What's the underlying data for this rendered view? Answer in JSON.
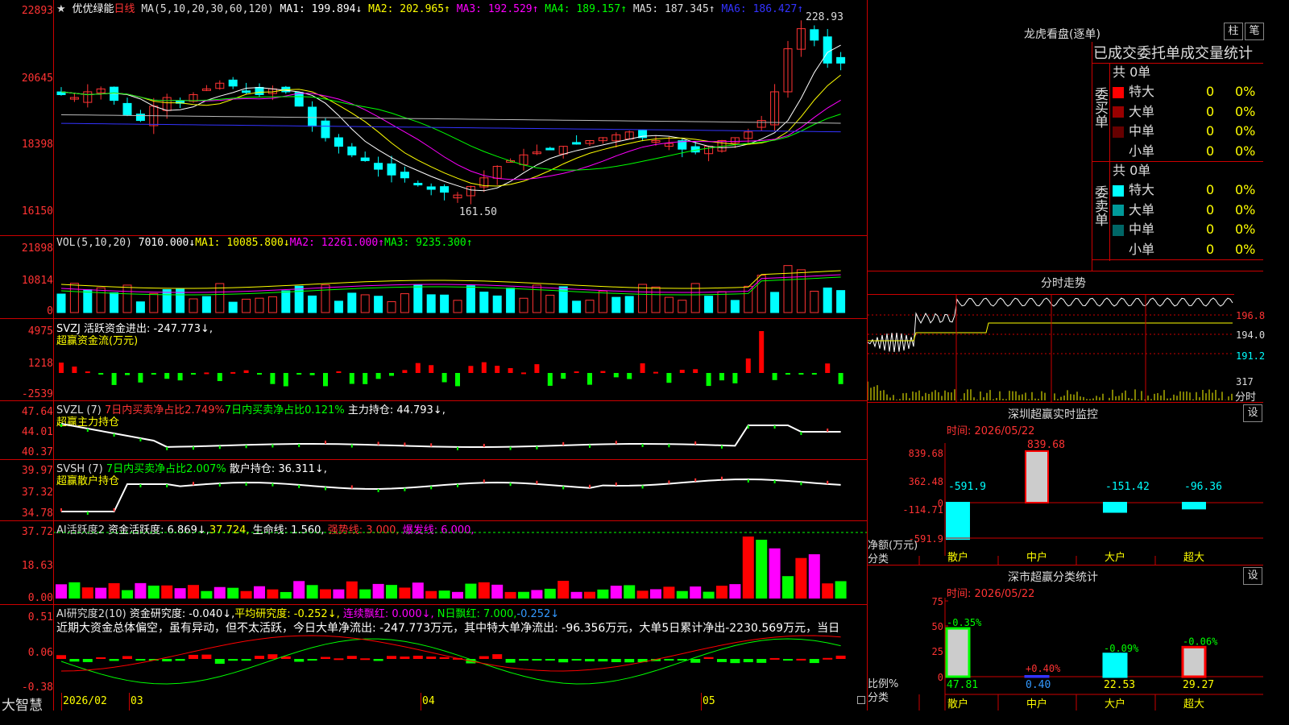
{
  "stock": {
    "name": "优优绿能",
    "period": "日线",
    "ma_label": "MA(5,10,20,30,60,120)",
    "ma": [
      {
        "label": "MA1: 199.894↓",
        "color": "#ffffff"
      },
      {
        "label": "MA2: 202.965↑",
        "color": "#ffff00"
      },
      {
        "label": "MA3: 192.529↑",
        "color": "#ff00ff"
      },
      {
        "label": "MA4: 189.157↑",
        "color": "#00ff00"
      },
      {
        "label": "MA5: 187.345↑",
        "color": "#cccccc"
      },
      {
        "label": "MA6: 186.427↑",
        "color": "#3333ff"
      }
    ],
    "price_axis": [
      "22893",
      "20645",
      "18398",
      "16150"
    ],
    "high_label": "228.93",
    "low_label": "161.50"
  },
  "vol": {
    "label": "VOL(5,10,20)",
    "value": "7010.000↓",
    "ma1": "MA1: 10085.800↓",
    "ma2": "MA2: 12261.000↑",
    "ma3": "MA3: 9235.300↑",
    "axis": [
      "21898",
      "10814",
      "0"
    ]
  },
  "svzj": {
    "label": "SVZJ  活跃资金进出: -247.773↓,",
    "sub": "超赢资金流(万元)",
    "axis": [
      "4975",
      "1218",
      "-2539"
    ]
  },
  "svzl": {
    "label": "SVZL (7)",
    "part1": "7日内买卖净占比2.749%",
    "part2": "7日内买卖净占比0.121%",
    "part3": "主力持仓: 44.793↓,",
    "sub": "超赢主力持仓",
    "axis": [
      "47.64",
      "44.01",
      "40.37"
    ]
  },
  "svsh": {
    "label": "SVSH (7)",
    "part1": "7日内买卖净占比2.007%",
    "part2": "散户持仓: 36.311↓,",
    "sub": "超赢散户持仓",
    "axis": [
      "39.97",
      "37.32",
      "34.78"
    ]
  },
  "ai1": {
    "label": "AI活跃度2",
    "part1": "资金活跃度: 6.869↓,",
    "part2": "37.724,",
    "part3": "生命线: 1.560,",
    "part4": "强势线: 3.000,",
    "part5": "爆发线: 6.000,",
    "axis": [
      "37.72",
      "18.63",
      "0.00"
    ]
  },
  "ai2": {
    "label": "AI研究度2(10)",
    "part1": "资金研究度: -0.040↓,",
    "part2": "平均研究度: -0.252↓,",
    "part3": "连续飘红: 0.000↓,",
    "part4": "N日飘红: 7.000,",
    "part5": "-0.252↓",
    "commentary": "近期大资金总体偏空，虽有异动，但不太活跃，今日大单净流出: -247.773万元，其中特大单净流出: -96.356万元，大单5日累计净出-2230.569万元，当日",
    "axis": [
      "0.51",
      "0.06",
      "-0.38"
    ]
  },
  "bottom": {
    "brand": "大智慧",
    "date_labels": [
      "2026/02",
      "03",
      "04",
      "05"
    ]
  },
  "right": {
    "title": "龙虎看盘(逐单)",
    "btn_bar": "柱",
    "btn_pen": "笔",
    "tabs": "已成交委托单成交量统计",
    "buy": {
      "side_label": "委买单",
      "total": "共 0单",
      "rows": [
        {
          "name": "特大",
          "count": "0",
          "pct": "0%",
          "color": "#ff0000"
        },
        {
          "name": "大单",
          "count": "0",
          "pct": "0%",
          "color": "#990000"
        },
        {
          "name": "中单",
          "count": "0",
          "pct": "0%",
          "color": "#660000"
        },
        {
          "name": "小单",
          "count": "0",
          "pct": "0%",
          "color": "#000000"
        }
      ]
    },
    "sell": {
      "side_label": "委卖单",
      "total": "共 0单",
      "rows": [
        {
          "name": "特大",
          "count": "0",
          "pct": "0%",
          "color": "#00ffff"
        },
        {
          "name": "大单",
          "count": "0",
          "pct": "0%",
          "color": "#009999"
        },
        {
          "name": "中单",
          "count": "0",
          "pct": "0%",
          "color": "#006666"
        },
        {
          "name": "小单",
          "count": "0",
          "pct": "0%",
          "color": "#000000"
        }
      ]
    },
    "intraday": {
      "title": "分时走势",
      "axis": [
        "196.8",
        "194.0",
        "191.2",
        "317"
      ],
      "vol_label": "分时"
    },
    "monitor": {
      "title": "深圳超赢实时监控",
      "settings": "设",
      "time": "时间: 2026/05/22",
      "axis": [
        "839.68",
        "362.48",
        "0",
        "-114.71",
        "-591.9"
      ],
      "net_label": "净额(万元)",
      "cat_label": "分类",
      "categories": [
        "散户",
        "中户",
        "大户",
        "超大"
      ],
      "values": [
        "-591.9",
        "839.68",
        "-151.42",
        "-96.36"
      ]
    },
    "classify": {
      "title": "深市超赢分类统计",
      "settings": "设",
      "time": "时间: 2026/05/22",
      "axis": [
        "75",
        "50",
        "25",
        "0"
      ],
      "ratio_label": "比例%",
      "cat_label": "分类",
      "categories": [
        "散户",
        "中户",
        "大户",
        "超大"
      ],
      "totals": [
        "47.81",
        "0.40",
        "22.53",
        "29.27"
      ],
      "changes": [
        "-0.35%",
        "+0.40%",
        "-0.09%",
        "-0.06%"
      ]
    }
  }
}
